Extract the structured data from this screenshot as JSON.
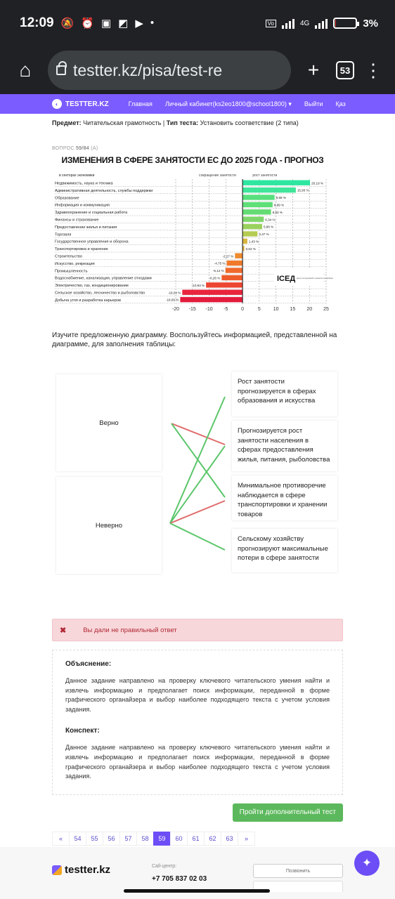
{
  "status": {
    "time": "12:09",
    "network": "4G",
    "battery": "3%"
  },
  "browser": {
    "url": "testter.kz/pisa/test-re",
    "tab_count": "53"
  },
  "nav": {
    "brand": "TESTTER.KZ",
    "items": [
      "Главная",
      "Личный кабинет(ks2eo1800@school1800) ▾",
      "Выйти",
      "Қаз"
    ]
  },
  "meta": {
    "subject_label": "Предмет:",
    "subject_value": "Читательская грамотность",
    "type_label": "Тип теста:",
    "type_value": "Установить соответствие (2 типа)"
  },
  "question": {
    "label": "ВОПРОС",
    "number": "59/84",
    "extra": "(A)"
  },
  "chart_data": {
    "type": "bar",
    "title": "ИЗМЕНЕНИЯ В СФЕРЕ ЗАНЯТОСТИ ЕС ДО 2025 ГОДА - ПРОГНОЗ",
    "column_header": "в секторах экономики",
    "legend_left": "сокращение занятости",
    "legend_right": "рост занятости",
    "logo": "ICEД",
    "logo_subtext": "Центр исследований и развития профобразования",
    "categories": [
      "Недвижимость, наука и техника",
      "Административная деятельность, службы поддержки",
      "Образование",
      "Информация и коммуникация",
      "Здравоохранение и социальная работа",
      "Финансы и страхование",
      "Предоставление жилья и питания",
      "Торговля",
      "Государственное управление и оборона",
      "Транспортировка и хранение",
      "Строительство",
      "Искусство, рекреация",
      "Промышленность",
      "Водоснабжение, канализация, управление отходами",
      "Электричество, газ, кондиционирование",
      "Сельское хозяйство, лесничество и рыболовство",
      "Добыча угля и разработка карьеров"
    ],
    "values": [
      20.19,
      15.93,
      9.58,
      8.99,
      8.53,
      6.34,
      5.86,
      4.47,
      1.43,
      0.52,
      -2.27,
      -4.75,
      -5.12,
      -6.26,
      -10.93,
      -18.04,
      -18.66
    ],
    "value_labels": [
      "20,19 %",
      "15,93 %",
      "9,58 %",
      "8,99 %",
      "8,53 %",
      "6,34 %",
      "5,86 %",
      "4,47 %",
      "1,43 %",
      "0,52 %",
      "-2,27 %",
      "-4,75 %",
      "-5,12 %",
      "-6,26 %",
      "-10,93 %",
      "-18,04 %",
      "-18,66 %"
    ],
    "xlim": [
      -20,
      25
    ],
    "xticks": [
      "-20",
      "-15",
      "-10",
      "-5",
      "0",
      "5",
      "10",
      "15",
      "20",
      "25"
    ],
    "colors": [
      "#2ee6a0",
      "#3ee59a",
      "#58e07e",
      "#5edf78",
      "#64dc74",
      "#7ed66a",
      "#9ad15e",
      "#b5cc52",
      "#d8b63d",
      "#dfae39",
      "#ee8a2e",
      "#f07a2c",
      "#ef6a2c",
      "#ee5c2c",
      "#ec4632",
      "#e8243c",
      "#e31b3c"
    ]
  },
  "instruction": "Изучите предложенную диаграмму. Воспользуйтесь информацией, представленной на диаграмме, для заполнения таблицы:",
  "matching": {
    "left": [
      "Верно",
      "Неверно"
    ],
    "right": [
      "Рост занятости прогнозируется в сферах образования и искусства",
      "Прогнозируется рост занятости населения в сферах предоставления жилья, питания, рыболовства",
      "Минимальное противоречие наблюдается в сфере транспортировки и хранении товаров",
      "Сельскому хозяйству прогнозируют максимальные потери в сфере занятости"
    ],
    "colors": {
      "correct": "#5cc66b",
      "wrong": "#e06a6a"
    }
  },
  "alert": {
    "icon": "✖",
    "text": "Вы дали не правильный ответ"
  },
  "explanation": {
    "title1": "Объяснение:",
    "text1": "Данное задание направлено на проверку ключевого читательского умения найти и извлечь информацию и предполагает поиск информации, переданной в форме графического органайзера и выбор наиболее подходящего текста с учетом условия задания.",
    "title2": "Конспект:",
    "text2": "Данное задание направлено на проверку ключевого читательского умения найти и извлечь информацию и предполагает поиск информации, переданной в форме графического органайзера и выбор наиболее подходящего текста с учетом условия задания."
  },
  "more_button": "Пройти дополнительный тест",
  "pager": [
    "«",
    "54",
    "55",
    "56",
    "57",
    "58",
    "59",
    "60",
    "61",
    "62",
    "63",
    "»"
  ],
  "pager_active": "59",
  "footer": {
    "brand": "testter.kz",
    "call_center": "Call-центр:",
    "phone": "+7 705 837 02 03",
    "call_button": "Позвонить"
  }
}
